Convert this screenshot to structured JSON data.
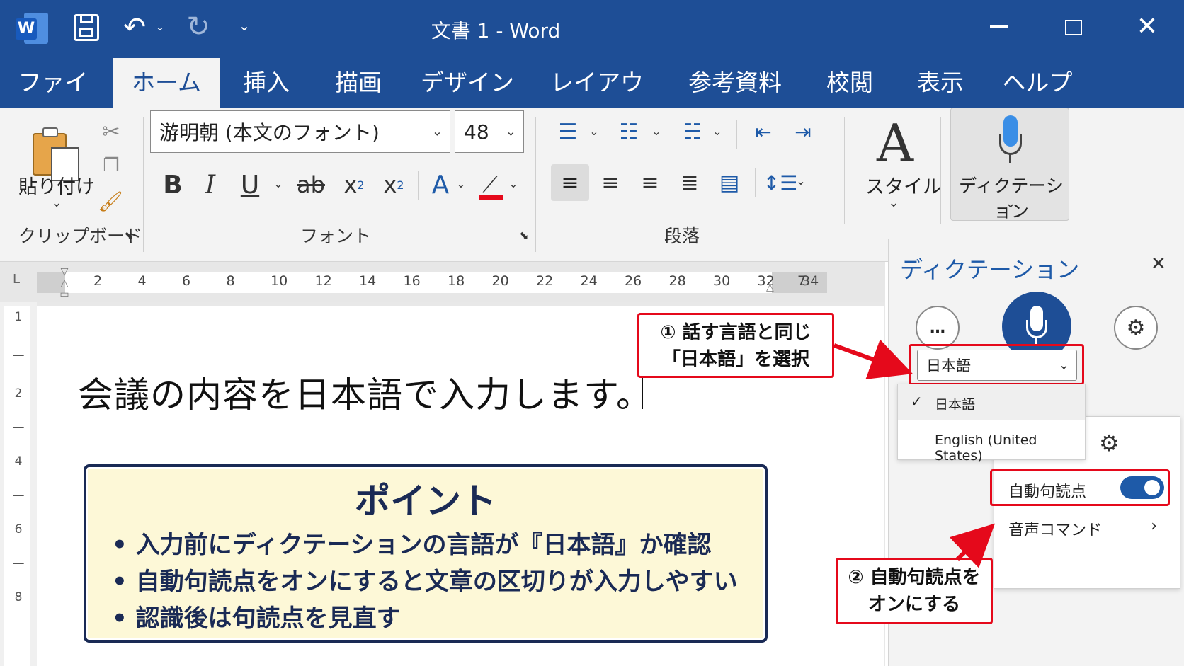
{
  "app": {
    "title": "文書 1 - Word",
    "logo": "W"
  },
  "tabs": [
    {
      "label": "ファイル"
    },
    {
      "label": "ホーム",
      "active": true
    },
    {
      "label": "挿入"
    },
    {
      "label": "描画"
    },
    {
      "label": "デザイン"
    },
    {
      "label": "レイアウト"
    },
    {
      "label": "参考資料"
    },
    {
      "label": "校閲"
    },
    {
      "label": "表示"
    },
    {
      "label": "ヘルプ"
    }
  ],
  "ribbon": {
    "clipboard": {
      "paste_label": "貼り付け",
      "group_label": "クリップボード"
    },
    "font": {
      "font_name": "游明朝 (本文のフォント)",
      "font_size": "48",
      "group_label": "フォント",
      "bold": "B",
      "italic": "I",
      "underline": "U",
      "strike": "ab",
      "sub": "x",
      "sub_index": "2",
      "sup": "x",
      "sup_index": "2",
      "font_color": "A"
    },
    "paragraph": {
      "group_label": "段落"
    },
    "styles": {
      "label": "スタイル"
    },
    "dictation": {
      "label": "ディクテーション"
    }
  },
  "ruler": {
    "ticks": [
      "2",
      "4",
      "6",
      "8",
      "10",
      "12",
      "14",
      "16",
      "18",
      "20",
      "22",
      "24",
      "26",
      "28",
      "30",
      "32",
      "34"
    ],
    "end_mark": "7",
    "corner": "L"
  },
  "vruler": [
    "1",
    "2",
    "4",
    "6",
    "8"
  ],
  "document": {
    "text": "会議の内容を日本語で入力します。"
  },
  "point_box": {
    "title": "ポイント",
    "bullets": [
      "入力前にディクテーションの言語が『日本語』か確認",
      "自動句読点をオンにすると文章の区切りが入力しやすい",
      "認識後は句読点を見直す"
    ]
  },
  "dictation_panel": {
    "title": "ディクテーション",
    "more": "…",
    "language_selected": "日本語",
    "language_options": [
      {
        "label": "日本語",
        "checked": true
      },
      {
        "label": "English (United States)",
        "checked": false
      }
    ],
    "settings": {
      "auto_punct_label": "自動句読点",
      "auto_punct_on": true,
      "voice_cmd_label": "音声コマンド"
    }
  },
  "callouts": {
    "step1_line1": "① 話す言語と同じ",
    "step1_line2": "「日本語」を選択",
    "step2_line1": "② 自動句読点を",
    "step2_line2": "オンにする"
  },
  "colors": {
    "brand": "#1e4e96",
    "highlight_red": "#e5091b",
    "toggle_blue": "#1e5aa8",
    "point_bg": "#fdf8d7"
  }
}
